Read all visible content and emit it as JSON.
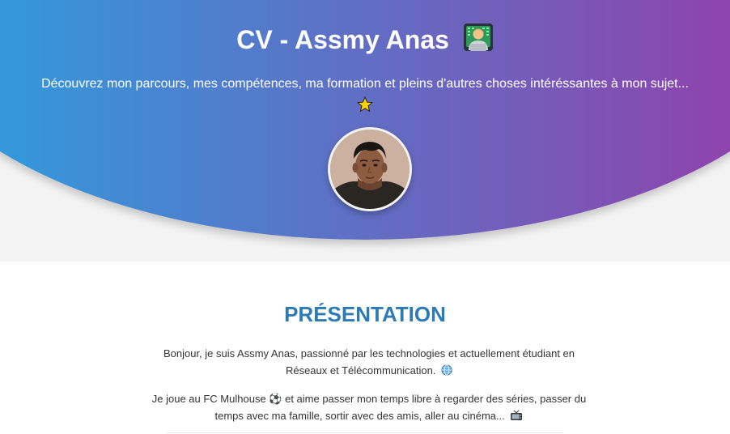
{
  "hero": {
    "title": "CV - Assmy Anas",
    "title_emoji": "technologist-emoji",
    "subtitle": "Découvrez mon parcours, mes compétences, ma formation et pleins d'autres choses intéréssantes à mon sujet...",
    "subtitle_emoji": "star-emoji",
    "gradient_start": "#3498db",
    "gradient_end": "#8e44ad"
  },
  "profile": {
    "photo": "profile-photo"
  },
  "presentation": {
    "title": "PRÉSENTATION",
    "title_color": "#2c7ab6",
    "paragraph1": "Bonjour, je suis Assmy Anas, passionné par les technologies et actuellement étudiant en Réseaux et Télécommunication.",
    "paragraph1_icon": "globe-icon",
    "paragraph2": "Je joue au FC Mulhouse ⚽ et aime passer mon temps libre à regarder des séries, passer du temps avec ma famille, sortir avec des amis, aller au cinéma...",
    "paragraph2_icon": "tv-icon"
  }
}
